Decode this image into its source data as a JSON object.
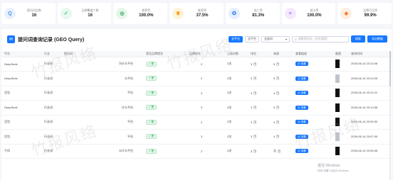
{
  "stats": [
    {
      "label": "提问词总数",
      "value": "16",
      "icon": "search-icon",
      "color": "#4a90e2",
      "bg": "#e8f1fd"
    },
    {
      "label": "品牌覆盖个数",
      "value": "16",
      "icon": "check-icon",
      "color": "#22c55e",
      "bg": "#e7f8ee"
    },
    {
      "label": "推荐率",
      "value": "100.0%",
      "icon": "target-icon",
      "color": "#16a34a",
      "bg": "#e6f6ea"
    },
    {
      "label": "推荐率",
      "value": "37.5%",
      "icon": "trophy-icon",
      "color": "#f59e0b",
      "bg": "#fdf2dc"
    },
    {
      "label": "前三率",
      "value": "81.3%",
      "icon": "medal-icon",
      "color": "#3b82f6",
      "bg": "#e6effd"
    },
    {
      "label": "前五率",
      "value": "100.0%",
      "icon": "list-icon",
      "color": "#a855f7",
      "bg": "#f3e8fd"
    },
    {
      "label": "品牌可见率",
      "value": "99.9%",
      "icon": "shield-icon",
      "color": "#f97316",
      "bg": "#fdeee2"
    }
  ],
  "panel": {
    "title": "提问词查询记录 (GEO Query)",
    "filters": {
      "chip1": "全平台",
      "chip2": "全平台",
      "select": "全部词",
      "search_placeholder": "搜索提问词（回车搜索）",
      "search_button": "搜索",
      "export_button": "导出数据"
    }
  },
  "table": {
    "columns": [
      "平台",
      "行业",
      "提问词",
      "是否品牌提及",
      "品牌排名",
      "正面次数",
      "排名",
      "来源",
      "查看链接",
      "截图",
      "查询时间"
    ],
    "view_label": "查看",
    "rows": [
      {
        "platform": "DeepSeek",
        "industry": "行业词",
        "query": "为什么平台",
        "badge": "是",
        "rank": "2",
        "count": "2次",
        "pos": "3",
        "source": "5",
        "time": "2026-06-14 23:13:48"
      },
      {
        "platform": "DeepSeek",
        "industry": "行业词",
        "query": "么平台",
        "badge": "是",
        "rank": "2",
        "count": "2次",
        "pos": "3",
        "source": "5",
        "time": "2026-06-14 23:13:25"
      },
      {
        "platform": "豆包",
        "industry": "行业词",
        "query": "平台",
        "badge": "是",
        "rank": "3",
        "count": "2次",
        "pos": "3",
        "source": "4",
        "time": "2026-06-14 23:11:20"
      },
      {
        "platform": "DeepSeek",
        "industry": "行业词",
        "query": "什么平台",
        "badge": "是",
        "rank": "3",
        "count": "2次",
        "pos": "3",
        "source": "5",
        "time": "2026-06-14 23:10:56"
      },
      {
        "platform": "豆包",
        "industry": "行业词",
        "query": "平台",
        "badge": "是",
        "rank": "2",
        "count": "2次",
        "pos": "3",
        "source": "4",
        "time": "2026-06-14 23:09:30"
      },
      {
        "platform": "豆包",
        "industry": "行业词",
        "query": "平台",
        "badge": "是",
        "rank": "3",
        "count": "2次",
        "pos": "3",
        "source": "4",
        "time": "2026-06-14 23:07:09"
      },
      {
        "platform": "千问",
        "industry": "行业词",
        "query": "么什么平台",
        "badge": "是",
        "rank": "2",
        "count": "2次",
        "pos": "3",
        "source": "无",
        "time": "2026-06-14 23:05:46"
      }
    ]
  },
  "watermark": "竹报风络",
  "activate": {
    "line1": "激活 Windows",
    "line2": "转到\"设置\"以激活 Windows。"
  }
}
